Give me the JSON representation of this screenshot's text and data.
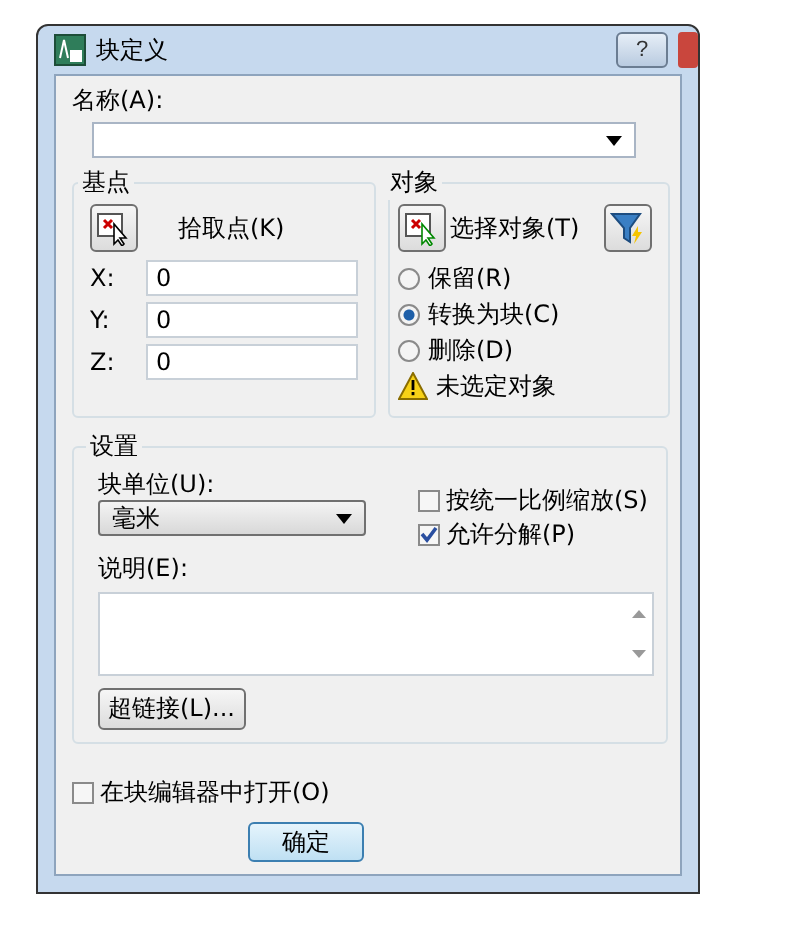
{
  "window": {
    "title": "块定义",
    "help_button": "?"
  },
  "name": {
    "label": "名称(A):"
  },
  "base_point": {
    "title": "基点",
    "pick_button": "拾取点(K)",
    "coords": [
      {
        "label": "X:",
        "value": "0"
      },
      {
        "label": "Y:",
        "value": "0"
      },
      {
        "label": "Z:",
        "value": "0"
      }
    ]
  },
  "objects": {
    "title": "对象",
    "select_button": "选择对象(T)",
    "options": [
      {
        "label": "保留(R)",
        "selected": false
      },
      {
        "label": "转换为块(C)",
        "selected": true
      },
      {
        "label": "删除(D)",
        "selected": false
      }
    ],
    "warning": "未选定对象"
  },
  "settings": {
    "title": "设置",
    "unit_label": "块单位(U):",
    "unit_value": "毫米",
    "checks": [
      {
        "label": "按统一比例缩放(S)",
        "checked": false
      },
      {
        "label": "允许分解(P)",
        "checked": true
      }
    ],
    "description_label": "说明(E):",
    "hyperlink_button": "超链接(L)..."
  },
  "open_in_editor": {
    "label": "在块编辑器中打开(O)",
    "checked": false
  },
  "buttons": [
    "确定"
  ]
}
